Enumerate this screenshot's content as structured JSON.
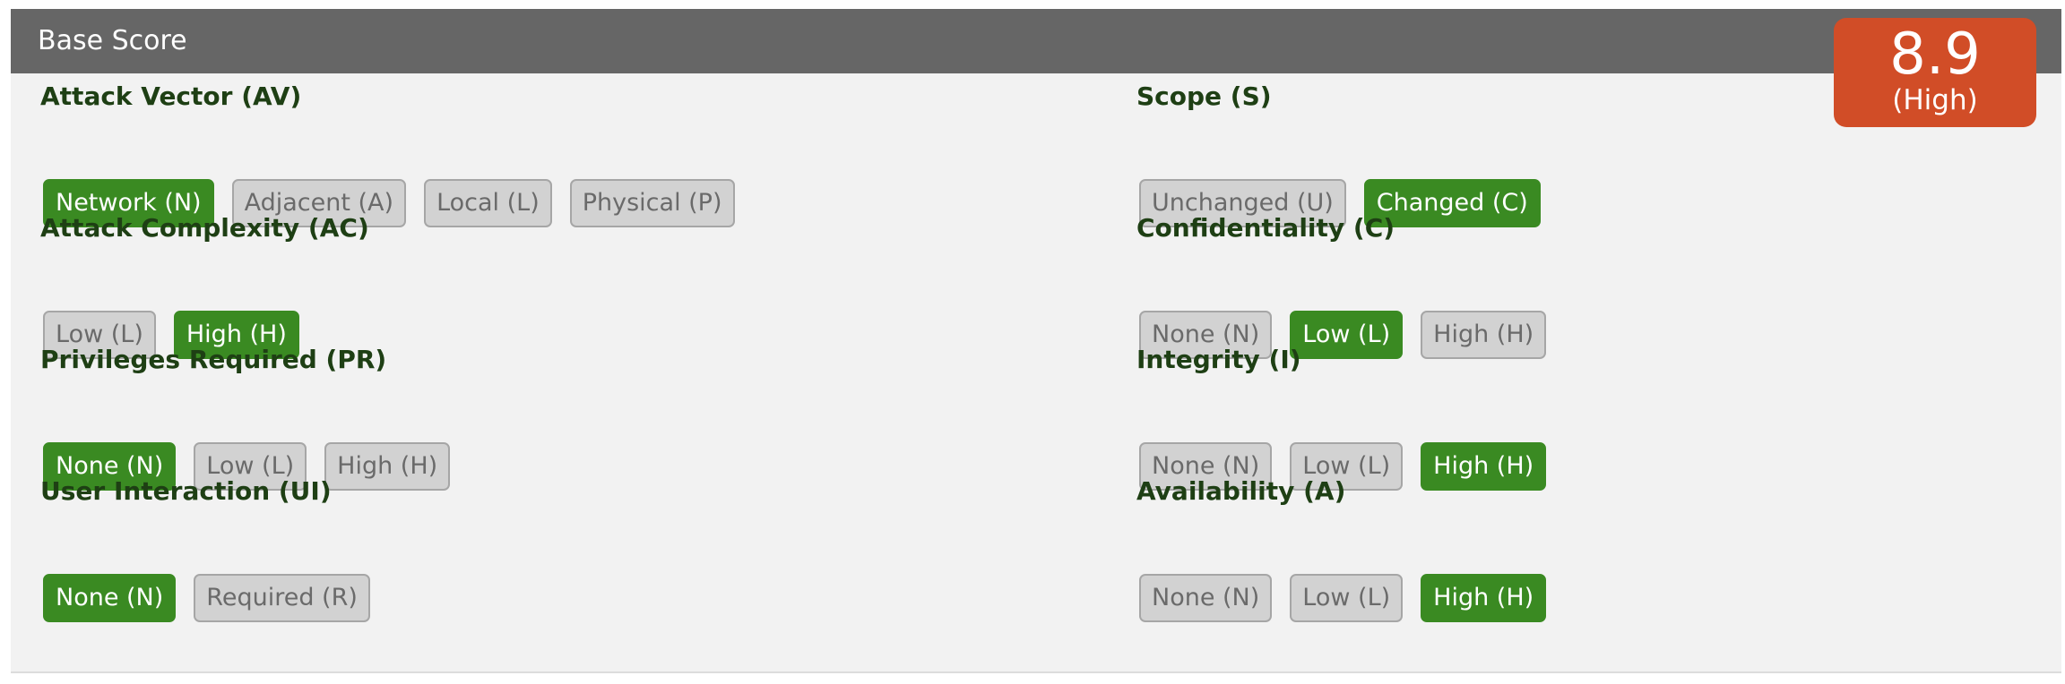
{
  "header": {
    "title": "Base Score"
  },
  "score": {
    "value": "8.9",
    "severity": "(High)",
    "color": "#d14d27"
  },
  "colors": {
    "selected": "#3a8a22",
    "unselected": "#d2d2d2",
    "heading": "#1e3f14",
    "header_bar": "#666666"
  },
  "metrics": {
    "av": {
      "title": "Attack Vector (AV)",
      "options": [
        "Network (N)",
        "Adjacent (A)",
        "Local (L)",
        "Physical (P)"
      ],
      "selected": 0
    },
    "ac": {
      "title": "Attack Complexity (AC)",
      "options": [
        "Low (L)",
        "High (H)"
      ],
      "selected": 1
    },
    "pr": {
      "title": "Privileges Required (PR)",
      "options": [
        "None (N)",
        "Low (L)",
        "High (H)"
      ],
      "selected": 0
    },
    "ui": {
      "title": "User Interaction (UI)",
      "options": [
        "None (N)",
        "Required (R)"
      ],
      "selected": 0
    },
    "s": {
      "title": "Scope (S)",
      "options": [
        "Unchanged (U)",
        "Changed (C)"
      ],
      "selected": 1
    },
    "c": {
      "title": "Confidentiality (C)",
      "options": [
        "None (N)",
        "Low (L)",
        "High (H)"
      ],
      "selected": 1
    },
    "i": {
      "title": "Integrity (I)",
      "options": [
        "None (N)",
        "Low (L)",
        "High (H)"
      ],
      "selected": 2
    },
    "a": {
      "title": "Availability (A)",
      "options": [
        "None (N)",
        "Low (L)",
        "High (H)"
      ],
      "selected": 2
    }
  }
}
